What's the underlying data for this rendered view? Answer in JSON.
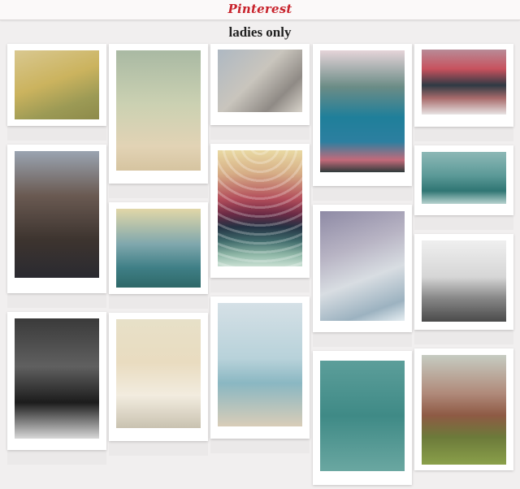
{
  "header": {
    "logo": "Pinterest",
    "board_title": "ladies only"
  },
  "columns": [
    [
      {
        "subject": "woman-silhouette-on-hill",
        "bg": "linear-gradient(160deg,#d9c890 0%,#cbb35e 45%,#9c9a55 75%,#8d8a4a 100%)"
      },
      {
        "subject": "woman-carrying-surfboard-in-net",
        "bg": "linear-gradient(180deg,#9aa4b1 0%,#6a5a52 35%,#3d342f 70%,#2a2a30 100%)"
      },
      {
        "subject": "bw-surfer-girl-in-bikini",
        "bg": "linear-gradient(180deg,#3a3a3a 0%,#606060 40%,#1c1c1c 70%,#d8d8d8 100%)"
      }
    ],
    [
      {
        "subject": "girl-with-wooden-surfboard-in-shallows",
        "bg": "linear-gradient(180deg,#a9b9a3 0%,#cbd1b2 45%,#e2d3b5 80%,#d6c4a0 100%)"
      },
      {
        "subject": "swimmer-underwater-shot",
        "bg": "linear-gradient(180deg,#e1d7a8 0%,#7fa7ad 45%,#3f7f86 75%,#2e6868 100%)"
      },
      {
        "subject": "blonde-girl-in-white-dress",
        "bg": "linear-gradient(180deg,#e7e0c8 0%,#e9dcc0 40%,#f2ecdf 70%,#c9c2b0 100%)"
      }
    ],
    [
      {
        "subject": "collage-girls-and-tattooed-back",
        "bg": "linear-gradient(135deg,#aeb8c2 0%,#c9c5bd 45%,#8f8a85 75%,#d9d4cb 100%)"
      },
      {
        "subject": "scales-pattern-gradient",
        "bg": "repeating-radial-gradient(circle at 50% -8px,rgba(255,255,255,0.25) 0 3px,transparent 3px 11px),linear-gradient(180deg,#e9d9a3 0%,#d6ad86 20%,#b24c5a 42%,#6b2a45 55%,#243243 66%,#3f6a6b 78%,#8fb7a7 90%,#c9e0d3 100%)"
      },
      {
        "subject": "girl-with-pink-surfboard-on-beach",
        "bg": "linear-gradient(180deg,#d5e0e6 0%,#b8d2da 45%,#8ab7c2 65%,#d9cdb8 100%)"
      }
    ],
    [
      {
        "subject": "coastal-cliffs-and-ocean",
        "bg": "linear-gradient(180deg,#e5d4d9 0%,#6b8c86 30%,#1f7f9a 55%,#2c7fa0 75%,#c36a7a 90%,#2e3a3a 100%)"
      },
      {
        "subject": "palm-fronds-against-sky",
        "bg": "linear-gradient(160deg,#8e8aa5 0%,#b8b4c4 35%,#d8dde2 60%,#9cb2c0 85%,#e6eef2 100%)"
      },
      {
        "subject": "aerial-surfers-in-water",
        "bg": "linear-gradient(180deg,#5c9e9a 0%,#3f8a86 50%,#6aa7a1 100%)"
      }
    ],
    [
      {
        "subject": "striped-blankets-in-car",
        "bg": "linear-gradient(180deg,#b88b97 0%,#c7515d 30%,#2f3a44 55%,#a86b6b 75%,#e8e3e3 100%)"
      },
      {
        "subject": "surf-sea-wave-close-up",
        "bg": "linear-gradient(180deg,#8db8b6 0%,#5c9a98 45%,#2f7573 75%,#b7d3cf 100%)"
      },
      {
        "subject": "bw-legs-over-dunes",
        "bg": "linear-gradient(180deg,#efefef 0%,#d6d6d6 45%,#8a8a8a 70%,#4a4a4a 100%)"
      },
      {
        "subject": "woman-with-flower-bouquet-head",
        "bg": "linear-gradient(180deg,#c6ccc2 0%,#b08a7a 35%,#8e5a44 55%,#6c7a3a 75%,#8aa04a 100%)"
      }
    ]
  ]
}
